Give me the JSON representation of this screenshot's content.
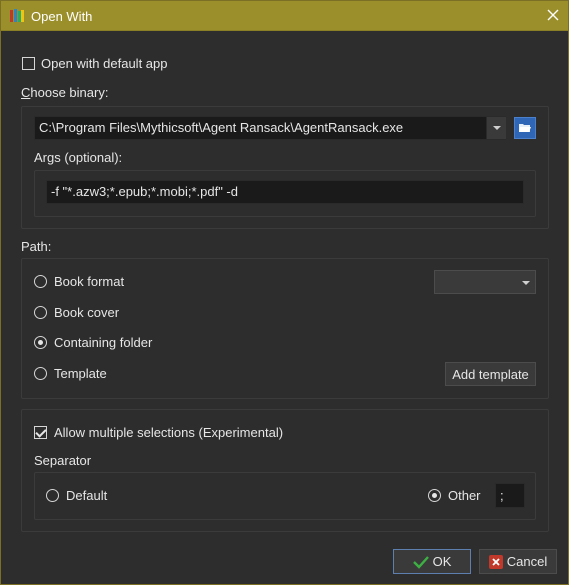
{
  "window": {
    "title": "Open With",
    "icon": "books-icon",
    "close_icon": "close-icon",
    "title_bar_color": "#9b8f2b"
  },
  "open_default": {
    "label": "Open with default app",
    "checked": false
  },
  "binary": {
    "label_prefix": "C",
    "label_rest": "hoose binary:",
    "value": "C:\\Program Files\\Mythicsoft\\Agent Ransack\\AgentRansack.exe",
    "browse_icon": "folder-open-icon",
    "args_label": "Args (optional):",
    "args_value": "-f \"*.azw3;*.epub;*.mobi;*.pdf\" -d"
  },
  "path": {
    "label": "Path:",
    "options": [
      {
        "label": "Book format",
        "checked": false
      },
      {
        "label": "Book cover",
        "checked": false
      },
      {
        "label": "Containing folder",
        "checked": true
      },
      {
        "label": "Template",
        "checked": false
      }
    ],
    "format_select_value": "",
    "add_template_label": "Add template"
  },
  "multi": {
    "label": "Allow multiple selections (Experimental)",
    "checked": true,
    "separator_label": "Separator",
    "default_label": "Default",
    "default_checked": false,
    "other_label": "Other",
    "other_checked": true,
    "other_value": ";"
  },
  "buttons": {
    "ok_label": "OK",
    "cancel_label": "Cancel",
    "ok_icon": "check-icon",
    "cancel_icon": "cancel-icon",
    "ok_icon_color": "#3cb043",
    "cancel_icon_color": "#c0392b"
  }
}
